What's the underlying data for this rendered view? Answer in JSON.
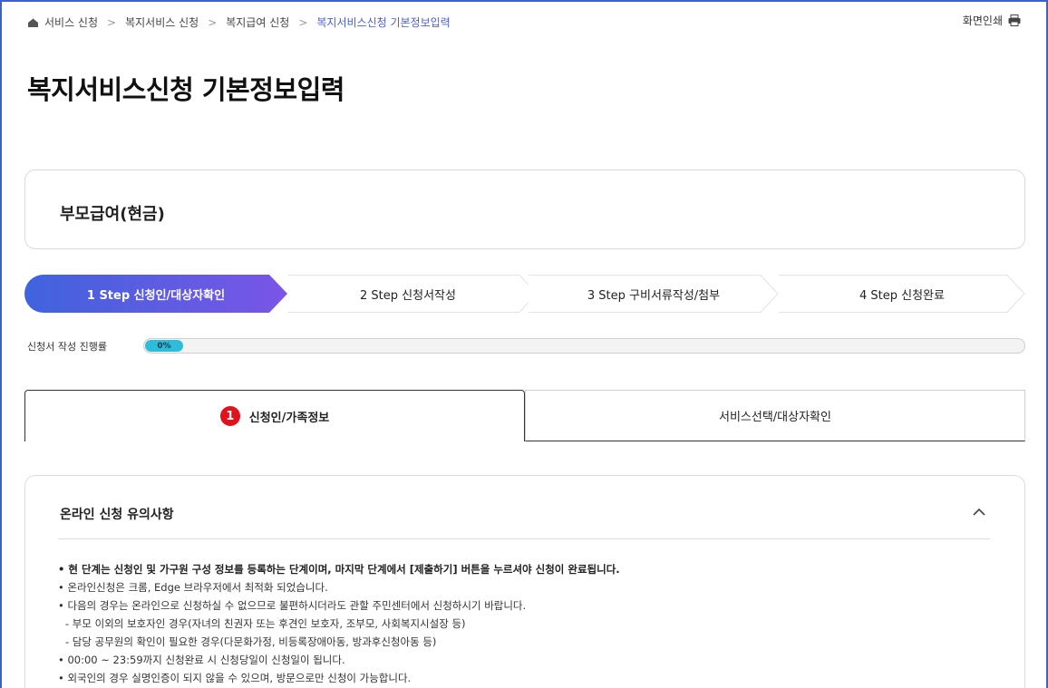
{
  "breadcrumb": {
    "items": [
      "서비스 신청",
      "복지서비스 신청",
      "복지급여 신청"
    ],
    "current": "복지서비스신청 기본정보입력",
    "separator": ">"
  },
  "print": {
    "label": "화면인쇄",
    "icon": "printer-icon"
  },
  "page_title": "복지서비스신청 기본정보입력",
  "service": {
    "name": "부모급여(현금)"
  },
  "steps": [
    {
      "label": "1 Step 신청인/대상자확인",
      "active": true
    },
    {
      "label": "2 Step 신청서작성",
      "active": false
    },
    {
      "label": "3 Step 구비서류작성/첨부",
      "active": false
    },
    {
      "label": "4 Step 신청완료",
      "active": false
    }
  ],
  "progress": {
    "label": "신청서 작성 진행률",
    "value_text": "0%",
    "value": 0
  },
  "tabs": [
    {
      "number": "1",
      "label": "신청인/가족정보",
      "active": true
    },
    {
      "label": "서비스선택/대상자확인",
      "active": false
    }
  ],
  "notice": {
    "title": "온라인 신청 유의사항",
    "items": [
      "• 현 단계는 신청인 및 가구원 구성 정보를 등록하는 단계이며, 마지막 단계에서 [제출하기] 버튼을 누르셔야 신청이 완료됩니다.",
      "• 온라인신청은 크롬, Edge 브라우저에서 최적화 되었습니다.",
      "• 다음의 경우는 온라인으로 신청하실 수 없으므로 불편하시더라도 관할 주민센터에서 신청하시기 바랍니다.",
      "- 부모 이외의 보호자인 경우(자녀의 친권자 또는 후견인 보호자, 조부모, 사회복지시설장 등)",
      "- 담당 공무원의 확인이 필요한 경우(다문화가정, 비등록장애아동, 방과후신청아동 등)",
      "• 00:00 ~ 23:59까지 신청완료 시 신청당일이 신청일이 됩니다.",
      "• 외국인의 경우 실명인증이 되지 않을 수 있으며, 방문으로만 신청이 가능합니다."
    ]
  },
  "colors": {
    "accent": "#4a5fd6",
    "step_active_start": "#3f63de",
    "step_active_end": "#7a55e6",
    "progress": "#2dbcd9",
    "badge_red": "#e0121b",
    "frame": "#3b62c9"
  }
}
